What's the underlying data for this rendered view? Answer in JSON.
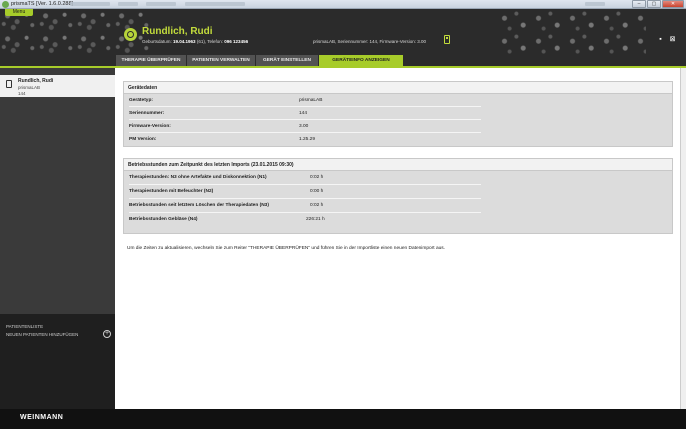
{
  "window": {
    "title": "prismaTS [Ver. 1.6.0.288]",
    "buttons": [
      "–",
      "▢",
      "✕"
    ]
  },
  "header": {
    "menu_label": "Menu",
    "patient_name": "Rundlich, Rudi",
    "birth_label": "Geburtsdatum:",
    "birth_date": "19.04.1963",
    "age": "(61),",
    "phone_label": "Telefon:",
    "phone": "096 123456",
    "device_info": "prismaLAB,  Seriennummer: 144,  Firmware-Version: 3.00"
  },
  "tabs": [
    {
      "label": "THERAPIE ÜBERPRÜFEN",
      "active": false
    },
    {
      "label": "PATIENTEN VERWALTEN",
      "active": false
    },
    {
      "label": "GERÄT EINSTELLEN",
      "active": false
    },
    {
      "label": "GERÄTEINFO ANZEIGEN",
      "active": true
    }
  ],
  "sidebar": {
    "patient_name": "Rundlich, Rudi",
    "device": "prismaLAB",
    "serial": "144",
    "patient_list_label": "PATIENTENLISTE",
    "add_patient_label": "NEUEN PATIENTEN HINZUFÜGEN"
  },
  "device_data": {
    "header": "Gerätedaten",
    "rows": [
      {
        "label": "Gerätetyp:",
        "value": "prismaLAB"
      },
      {
        "label": "Seriennummer:",
        "value": "144"
      },
      {
        "label": "Firmware-Version:",
        "value": "3.00"
      },
      {
        "label": "PM Version:",
        "value": "1.25.29"
      }
    ]
  },
  "operating_hours": {
    "header": "Betriebsstunden zum Zeitpunkt des letzten Imports (23.01.2015 09:30)",
    "rows": [
      {
        "label": "Therapiestunden: N3 ohne Artefakte und Diskonnektion (N1)",
        "value": "0:02  h"
      },
      {
        "label": "Therapiestunden mit Befeuchter (N2)",
        "value": "0:00  h"
      },
      {
        "label": "Betriebsstunden seit letztem Löschen der Therapiedaten (N3)",
        "value": "0:02  h"
      },
      {
        "label": "Betriebsstunden Gebläse (N4)",
        "value": "226:21  h"
      }
    ]
  },
  "info_text": "Um die Zeiten zu aktualisieren, wechseln Sie zum Reiter \"THERAPIE  ÜBERPRÜFEN\" und führen Sie in der Importliste einen neuen Datenimport aus.",
  "footer": {
    "logo": "WEINMANN"
  }
}
